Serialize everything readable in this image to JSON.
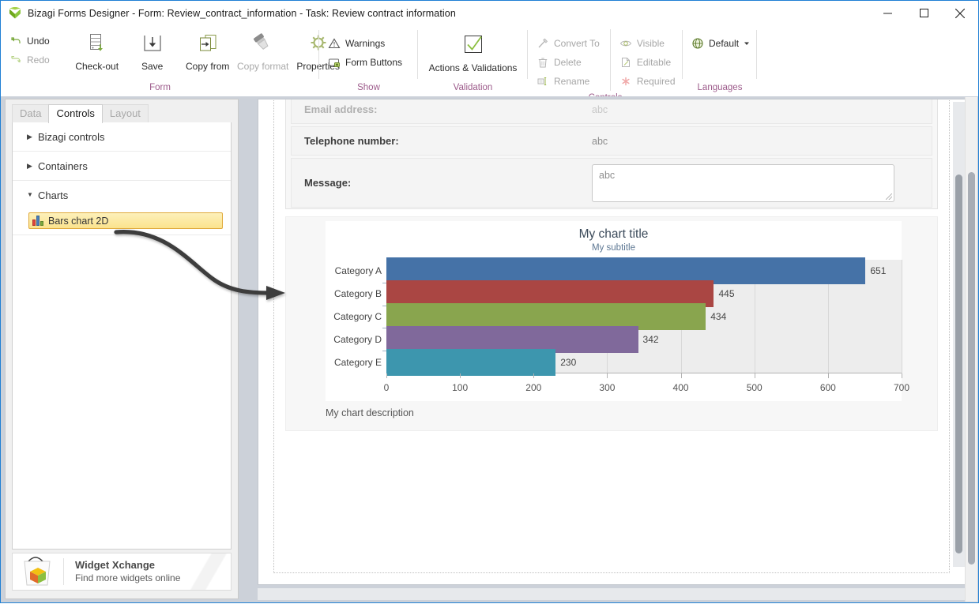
{
  "window": {
    "app_name": "Bizagi Forms Designer",
    "title": "Bizagi Forms Designer  - Form: Review_contract_information - Task:  Review contract information",
    "minimize_label": "Minimize",
    "maximize_label": "Maximize",
    "close_label": "Close"
  },
  "ribbon": {
    "groups": [
      {
        "name": "Form",
        "label": "Form",
        "small_items": [
          {
            "label": "Undo",
            "icon": "undo-icon",
            "enabled": true
          },
          {
            "label": "Redo",
            "icon": "redo-icon",
            "enabled": false
          }
        ],
        "large_items": [
          {
            "label": "Check-out",
            "icon": "check-out-icon",
            "enabled": true
          },
          {
            "label": "Save",
            "icon": "save-icon",
            "enabled": true
          },
          {
            "label": "Copy from",
            "icon": "copy-from-icon",
            "enabled": true
          },
          {
            "label": "Copy format",
            "icon": "copy-format-icon",
            "enabled": false
          },
          {
            "label": "Properties",
            "icon": "properties-gear-icon",
            "enabled": true
          }
        ]
      },
      {
        "name": "Show",
        "label": "Show",
        "small_items": [
          {
            "label": "Warnings",
            "icon": "warning-triangle-icon",
            "enabled": true
          },
          {
            "label": "Form Buttons",
            "icon": "form-buttons-icon",
            "enabled": true
          }
        ],
        "large_items": []
      },
      {
        "name": "Validation",
        "label": "Validation",
        "small_items": [],
        "large_items": [
          {
            "label": "Actions & Validations",
            "icon": "checkmark-box-icon",
            "enabled": true
          }
        ]
      },
      {
        "name": "Controls",
        "label": "Controls",
        "small_items": [
          {
            "label": "Convert To",
            "icon": "convert-to-icon",
            "enabled": false
          },
          {
            "label": "Delete",
            "icon": "trash-icon",
            "enabled": false
          },
          {
            "label": "Rename",
            "icon": "rename-icon",
            "enabled": false
          },
          {
            "label": "Visible",
            "icon": "eye-icon",
            "enabled": false
          },
          {
            "label": "Editable",
            "icon": "editable-page-icon",
            "enabled": false
          },
          {
            "label": "Required",
            "icon": "required-asterisk-icon",
            "enabled": false
          }
        ],
        "large_items": []
      },
      {
        "name": "Languages",
        "label": "Languages",
        "small_items": [
          {
            "label": "Default",
            "icon": "globe-icon",
            "enabled": true,
            "dropdown": true
          }
        ],
        "large_items": []
      }
    ]
  },
  "sidebar": {
    "tabs": [
      {
        "label": "Data",
        "active": false
      },
      {
        "label": "Controls",
        "active": true
      },
      {
        "label": "Layout",
        "active": false
      }
    ],
    "groups": [
      {
        "label": "Bizagi controls",
        "expanded": false,
        "items": []
      },
      {
        "label": "Containers",
        "expanded": false,
        "items": []
      },
      {
        "label": "Charts",
        "expanded": true,
        "items": [
          {
            "label": "Bars chart 2D",
            "icon": "bars-chart-2d-icon",
            "selected": true
          }
        ]
      }
    ],
    "widget_promo": {
      "title": "Widget Xchange",
      "subtitle": "Find more widgets online",
      "icon": "shopping-bag-icon"
    }
  },
  "form": {
    "fields": [
      {
        "label": "Email address:",
        "value": "abc",
        "type": "text",
        "dimmed": true
      },
      {
        "label": "Telephone number:",
        "value": "abc",
        "type": "text",
        "dimmed": false
      },
      {
        "label": "Message:",
        "value": "abc",
        "type": "textarea",
        "dimmed": false
      }
    ]
  },
  "chart_data": {
    "type": "bar",
    "orientation": "horizontal",
    "title": "My chart title",
    "subtitle": "My subtitle",
    "description": "My chart description",
    "categories": [
      "Category A",
      "Category B",
      "Category C",
      "Category D",
      "Category E"
    ],
    "values": [
      651,
      445,
      434,
      342,
      230
    ],
    "data_labels": [
      "651",
      "445",
      "434",
      "342",
      "230"
    ],
    "colors": [
      "#4572a7",
      "#aa4643",
      "#89a54e",
      "#80699b",
      "#3d96ae"
    ],
    "xlabel": "",
    "ylabel": "",
    "xlim": [
      0,
      700
    ],
    "xticks": [
      0,
      100,
      200,
      300,
      400,
      500,
      600,
      700
    ],
    "xtick_labels": [
      "0",
      "100",
      "200",
      "300",
      "400",
      "500",
      "600",
      "700"
    ],
    "grid": true,
    "legend": false,
    "plot_background": "#ededed"
  },
  "annotation": {
    "arrow": "curved-arrow-from-bars-chart-2d-to-canvas"
  }
}
